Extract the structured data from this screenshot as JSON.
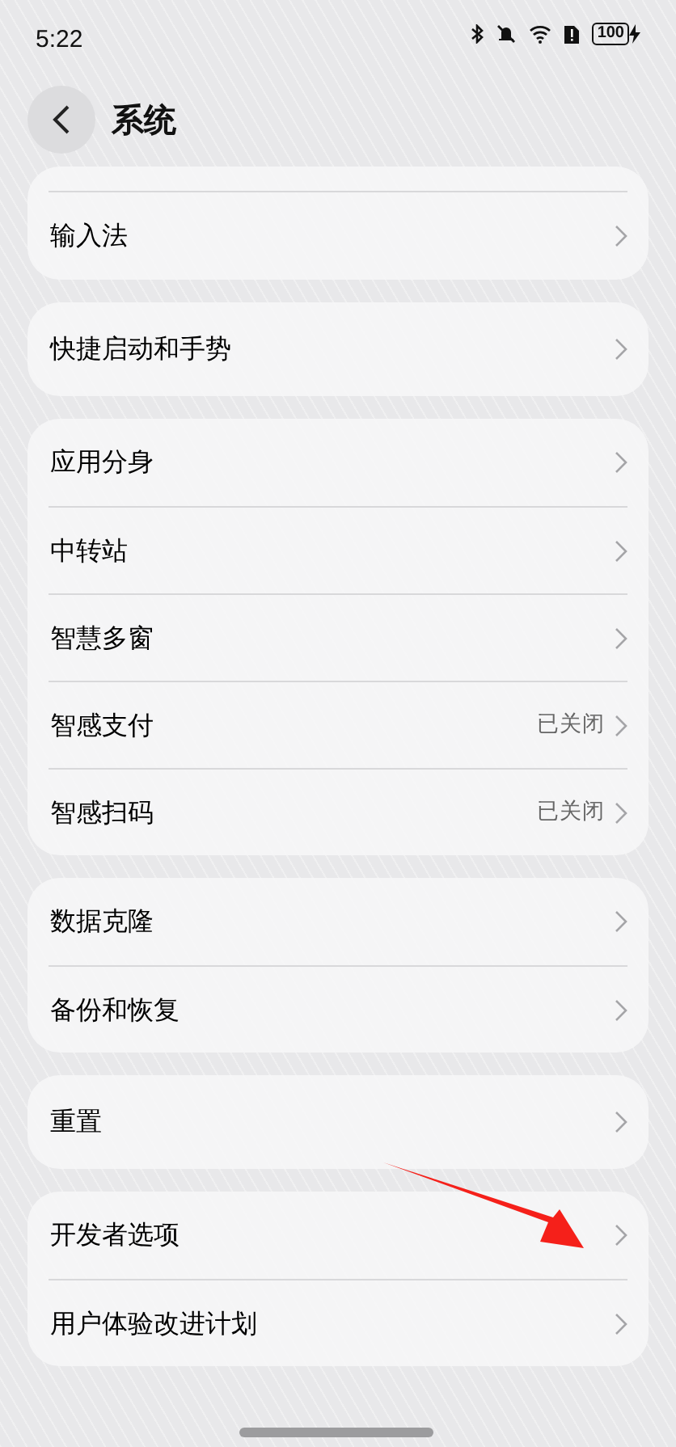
{
  "status_bar": {
    "time": "5:22",
    "battery": "100"
  },
  "header": {
    "title": "系统"
  },
  "groups": [
    {
      "items": [
        {
          "label": "输入法"
        }
      ]
    },
    {
      "items": [
        {
          "label": "快捷启动和手势"
        }
      ]
    },
    {
      "items": [
        {
          "label": "应用分身"
        },
        {
          "label": "中转站"
        },
        {
          "label": "智慧多窗"
        },
        {
          "label": "智感支付",
          "value": "已关闭"
        },
        {
          "label": "智感扫码",
          "value": "已关闭"
        }
      ]
    },
    {
      "items": [
        {
          "label": "数据克隆"
        },
        {
          "label": "备份和恢复"
        }
      ]
    },
    {
      "items": [
        {
          "label": "重置"
        }
      ]
    },
    {
      "items": [
        {
          "label": "开发者选项"
        },
        {
          "label": "用户体验改进计划"
        }
      ]
    }
  ]
}
